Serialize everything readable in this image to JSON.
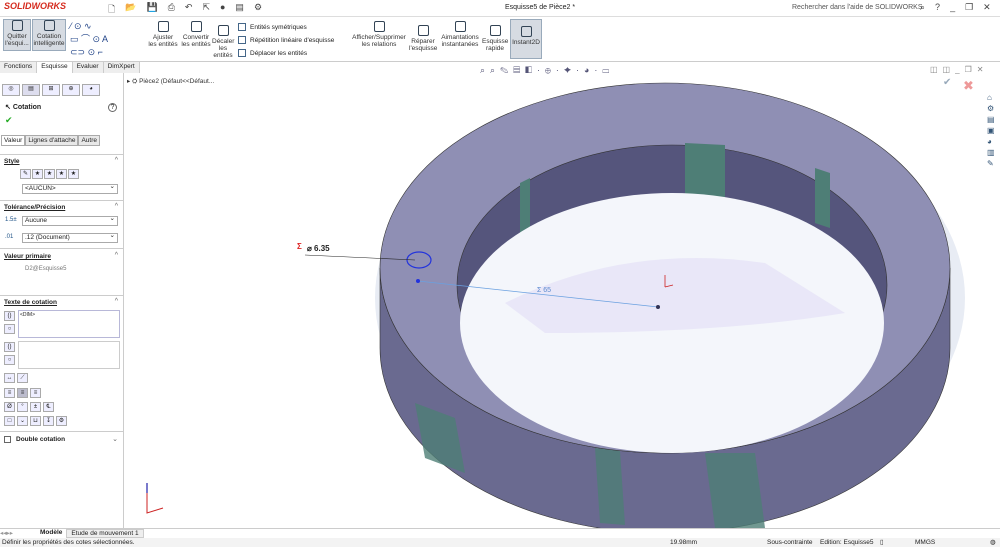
{
  "app": {
    "logo": "SOLIDWORKS",
    "title": "Esquisse5 de Pièce2 *",
    "help_search": "Rechercher dans l'aide de SOLIDWORKS"
  },
  "ribbon": {
    "exit_sketch": "Quitter l'esqui...",
    "smart_dim": "Cotation intelligente",
    "trim": "Ajuster les entités",
    "convert": "Convertir les entités",
    "offset": "Décaler les entités",
    "mirror": "Entités symétriques",
    "linear_pattern": "Répétition linéaire d'esquisse",
    "move": "Déplacer les entités",
    "relations": "Afficher/Supprimer les relations",
    "repair": "Réparer l'esquisse",
    "snaps": "Aimantations instantanées",
    "rapid": "Esquisse rapide",
    "instant2d": "Instant2D"
  },
  "tabs": [
    "Fonctions",
    "Esquisse",
    "Evaluer",
    "DimXpert"
  ],
  "panel": {
    "title": "Cotation",
    "subtabs": [
      "Valeur",
      "Lignes d'attache",
      "Autre"
    ],
    "style_label": "Style",
    "style_value": "<AUCUN>",
    "tolerance_label": "Tolérance/Précision",
    "tolerance_value": "Aucune",
    "precision_value": ".12 (Document)",
    "primary_label": "Valeur primaire",
    "primary_value": "D2@Esquisse5",
    "dimtext_label": "Texte de cotation",
    "dimtext_value": "<DIM>",
    "dual_label": "Double cotation"
  },
  "tree": {
    "part": "Pièce2 (Défaut<<Défaut..."
  },
  "viewport": {
    "dim_diameter": "⌀ 6.35",
    "dim_linear": "Σ 65"
  },
  "bottom_tabs": [
    "Modèle",
    "Etude de mouvement 1"
  ],
  "status": {
    "message": "Définir les propriétés des cotes sélectionnées.",
    "coord": "19.98mm",
    "state": "Sous-contrainte",
    "editing": "Edition: Esquisse5",
    "units": "MMGS"
  },
  "colors": {
    "face": "#8f8fb4",
    "dark": "#45456a",
    "teal": "#4e7e76",
    "accent": "#d52b1e"
  }
}
